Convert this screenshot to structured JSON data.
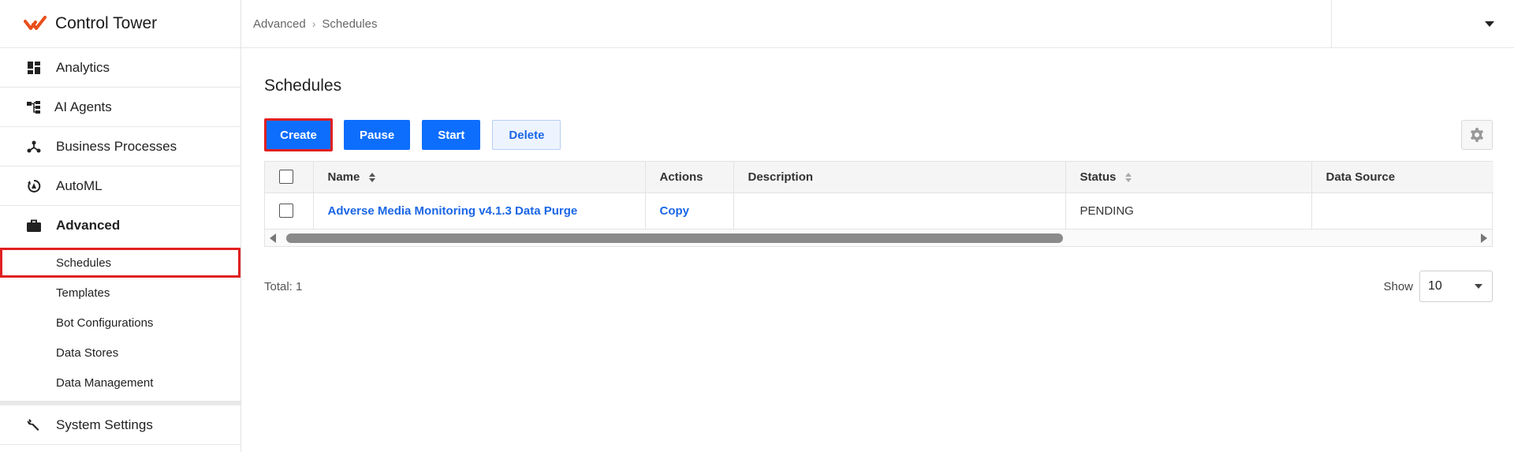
{
  "app": {
    "title": "Control Tower",
    "accent": "#e94e1b",
    "primary": "#0d6efd",
    "highlight": "#e02020"
  },
  "sidebar": {
    "items": [
      {
        "label": "Analytics",
        "icon": "dashboard-icon"
      },
      {
        "label": "AI Agents",
        "icon": "hierarchy-icon"
      },
      {
        "label": "Business Processes",
        "icon": "process-icon"
      },
      {
        "label": "AutoML",
        "icon": "automl-icon"
      },
      {
        "label": "Advanced",
        "icon": "briefcase-icon"
      }
    ],
    "sub_items": [
      {
        "label": "Schedules",
        "active": true
      },
      {
        "label": "Templates"
      },
      {
        "label": "Bot Configurations"
      },
      {
        "label": "Data Stores"
      },
      {
        "label": "Data Management"
      }
    ],
    "bottom_item": {
      "label": "System Settings",
      "icon": "wrench-icon"
    }
  },
  "breadcrumb": {
    "parent": "Advanced",
    "current": "Schedules"
  },
  "page": {
    "title": "Schedules"
  },
  "toolbar": {
    "create": "Create",
    "pause": "Pause",
    "start": "Start",
    "delete": "Delete"
  },
  "table": {
    "columns": [
      "Name",
      "Actions",
      "Description",
      "Status",
      "Data Source"
    ],
    "rows": [
      {
        "name": "Adverse Media Monitoring v4.1.3 Data Purge",
        "action": "Copy",
        "description": "",
        "status": "PENDING",
        "data_source": ""
      }
    ]
  },
  "footer": {
    "total": "Total: 1",
    "show_label": "Show",
    "page_size": "10"
  }
}
